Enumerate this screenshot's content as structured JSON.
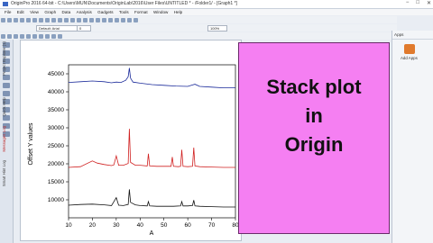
{
  "window": {
    "title": "OriginPro 2016 64-bit - C:\\Users\\MUN\\Documents\\OriginLab\\2016\\User Files\\UNTITLED * - /Folder1/ - [Graph1 *]",
    "controls": [
      "−",
      "□",
      "✕"
    ]
  },
  "menu": [
    "File",
    "Edit",
    "View",
    "Graph",
    "Data",
    "Analysis",
    "Gadgets",
    "Tools",
    "Format",
    "Window",
    "Help"
  ],
  "toolbar": {
    "font": "Default: Arial",
    "size": "0",
    "zoom": "100%"
  },
  "left_tabs": [
    "Project Explorer (1)",
    "Quick Help",
    "Messages Log",
    "Smart Hint Log"
  ],
  "right_panel": {
    "header": "Apps",
    "add_apps": "Add Apps"
  },
  "overlay": {
    "line1": "Stack plot",
    "line2": "in",
    "line3": "Origin",
    "color": "#f57ff2"
  },
  "chart_data": {
    "type": "line",
    "xlabel": "A",
    "ylabel": "Offset Y values",
    "xlim": [
      10,
      80
    ],
    "ylim": [
      5000,
      47500
    ],
    "x_ticks": [
      10,
      20,
      30,
      40,
      50,
      60,
      70,
      80
    ],
    "y_ticks": [
      10000,
      15000,
      20000,
      25000,
      30000,
      35000,
      40000,
      45000
    ],
    "x_tick_labels": [
      "10",
      "20",
      "30",
      "40",
      "50",
      "60",
      "70",
      "80"
    ],
    "y_tick_labels": [
      "10000",
      "15000",
      "20000",
      "25000",
      "30000",
      "35000",
      "40000",
      "45000"
    ],
    "series": [
      {
        "color": "#1a2a9a",
        "x": [
          10,
          15,
          20,
          25,
          28,
          30,
          32,
          34,
          35,
          35.5,
          36,
          37,
          40,
          45,
          50,
          55,
          60,
          62,
          63,
          65,
          70,
          75,
          80
        ],
        "y": [
          42600,
          42800,
          43000,
          42800,
          42500,
          42700,
          42600,
          43200,
          44200,
          46600,
          43800,
          42700,
          42400,
          42000,
          41800,
          41600,
          41500,
          41900,
          42100,
          41500,
          41300,
          41100,
          41100
        ]
      },
      {
        "color": "#d02020",
        "x": [
          10,
          15,
          20,
          22,
          25,
          28,
          29,
          30,
          31,
          33,
          35,
          35.5,
          36,
          38,
          40,
          43,
          43.5,
          44,
          47,
          50,
          53,
          53.5,
          54,
          56,
          57,
          57.5,
          58,
          60,
          62,
          62.5,
          63,
          65,
          70,
          75,
          80
        ],
        "y": [
          19000,
          19200,
          20800,
          20200,
          19800,
          19500,
          19700,
          22200,
          19600,
          19600,
          20100,
          29700,
          20400,
          19600,
          19600,
          19400,
          22800,
          19400,
          19300,
          19300,
          19300,
          21900,
          19300,
          19200,
          19300,
          23900,
          19300,
          19200,
          19300,
          24500,
          19400,
          19200,
          19100,
          19000,
          19000
        ]
      },
      {
        "color": "#111111",
        "x": [
          10,
          15,
          20,
          25,
          28,
          30,
          31,
          33,
          35,
          35.5,
          36,
          38,
          40,
          43,
          43.5,
          44,
          47,
          50,
          53,
          54,
          57,
          57.5,
          58,
          60,
          62,
          62.5,
          63,
          65,
          70,
          75,
          80
        ],
        "y": [
          8500,
          8700,
          8800,
          8600,
          8400,
          10600,
          8500,
          8400,
          8700,
          12900,
          9300,
          8600,
          8400,
          8300,
          9500,
          8300,
          8200,
          8200,
          8200,
          8200,
          8300,
          9500,
          8300,
          8300,
          8400,
          9900,
          8300,
          8200,
          8100,
          8000,
          8000
        ]
      }
    ]
  }
}
